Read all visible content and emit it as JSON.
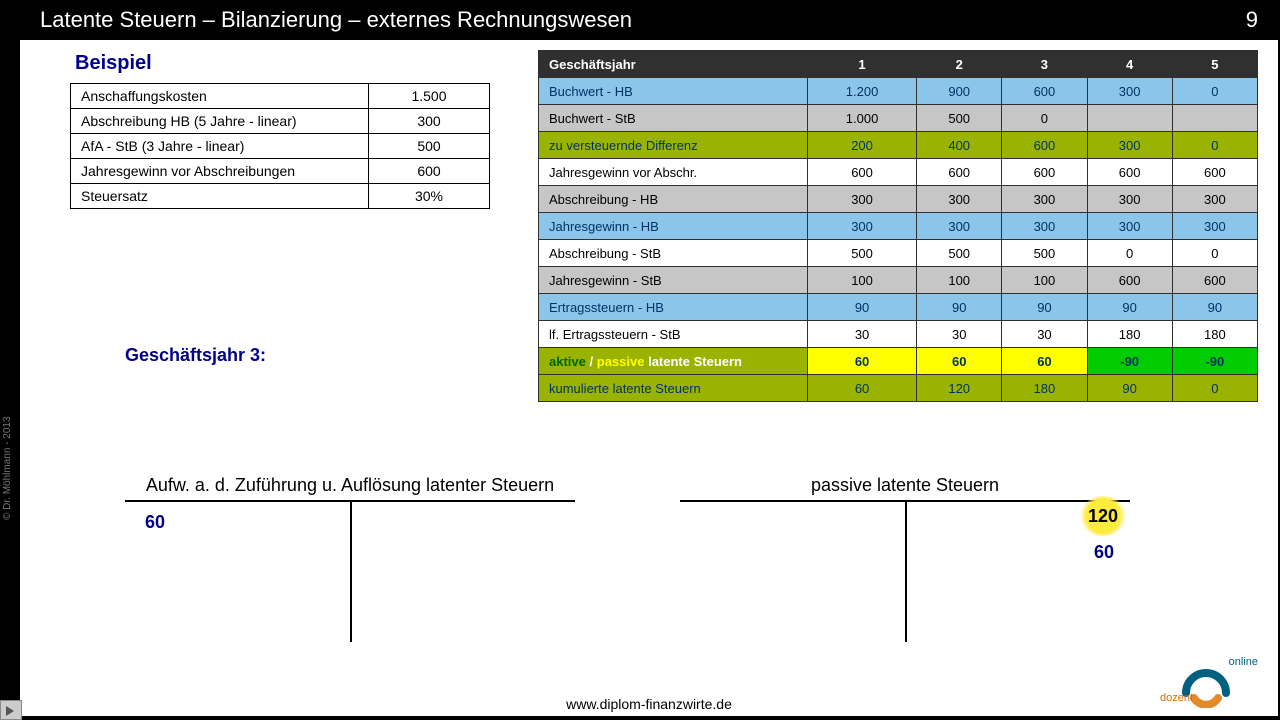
{
  "header": {
    "title": "Latente Steuern – Bilanzierung – externes Rechnungswesen",
    "page": "9"
  },
  "beispiel_label": "Beispiel",
  "assumptions": {
    "rows": [
      {
        "label": "Anschaffungskosten",
        "value": "1.500"
      },
      {
        "label": "Abschreibung HB  (5 Jahre - linear)",
        "value": "300"
      },
      {
        "label": "AfA - StB          (3 Jahre - linear)",
        "value": "500"
      },
      {
        "label": "Jahresgewinn vor Abschreibungen",
        "value": "600"
      },
      {
        "label": "Steuersatz",
        "value": "30%"
      }
    ]
  },
  "gj3_label": "Geschäftsjahr 3:",
  "calc": {
    "header_label": "Geschäftsjahr",
    "years": [
      "1",
      "2",
      "3",
      "4",
      "5"
    ],
    "rows": [
      {
        "class": "blue",
        "label": "Buchwert - HB",
        "values": [
          "1.200",
          "900",
          "600",
          "300",
          "0"
        ]
      },
      {
        "class": "grey",
        "label": "Buchwert - StB",
        "values": [
          "1.000",
          "500",
          "0",
          "",
          ""
        ]
      },
      {
        "class": "olive",
        "label": "zu versteuernde Differenz",
        "values": [
          "200",
          "400",
          "600",
          "300",
          "0"
        ]
      },
      {
        "class": "white",
        "label": "Jahresgewinn vor Abschr.",
        "values": [
          "600",
          "600",
          "600",
          "600",
          "600"
        ]
      },
      {
        "class": "grey",
        "label": "Abschreibung  - HB",
        "values": [
          "300",
          "300",
          "300",
          "300",
          "300"
        ]
      },
      {
        "class": "blue",
        "label": "Jahresgewinn - HB",
        "values": [
          "300",
          "300",
          "300",
          "300",
          "300"
        ]
      },
      {
        "class": "white",
        "label": "Abschreibung  - StB",
        "values": [
          "500",
          "500",
          "500",
          "0",
          "0"
        ]
      },
      {
        "class": "grey",
        "label": "Jahresgewinn - StB",
        "values": [
          "100",
          "100",
          "100",
          "600",
          "600"
        ]
      },
      {
        "class": "blue",
        "label": "Ertragssteuern - HB",
        "values": [
          "90",
          "90",
          "90",
          "90",
          "90"
        ]
      },
      {
        "class": "white",
        "label": "lf. Ertragssteuern - StB",
        "values": [
          "30",
          "30",
          "30",
          "180",
          "180"
        ]
      },
      {
        "class": "multi",
        "label": "aktive / passive latente Steuern",
        "values": [
          "60",
          "60",
          "60",
          "-90",
          "-90"
        ],
        "cell_classes": [
          "ycell",
          "ycell",
          "ycell",
          "gcell",
          "gcell"
        ]
      },
      {
        "class": "olive",
        "label": "kumulierte  latente Steuern",
        "values": [
          "60",
          "120",
          "180",
          "90",
          "0"
        ]
      }
    ]
  },
  "tacc_left": {
    "title": "Aufw. a. d. Zuführung u. Auflösung latenter Steuern",
    "left": "60"
  },
  "tacc_right": {
    "title": "passive latente Steuern",
    "highlight": "120",
    "r2": "60"
  },
  "footer_url": "www.diplom-finanzwirte.de",
  "copyright": "© Dr. Möhlmann - 2013",
  "logo": {
    "dozent": "dozent",
    "online": "online"
  }
}
